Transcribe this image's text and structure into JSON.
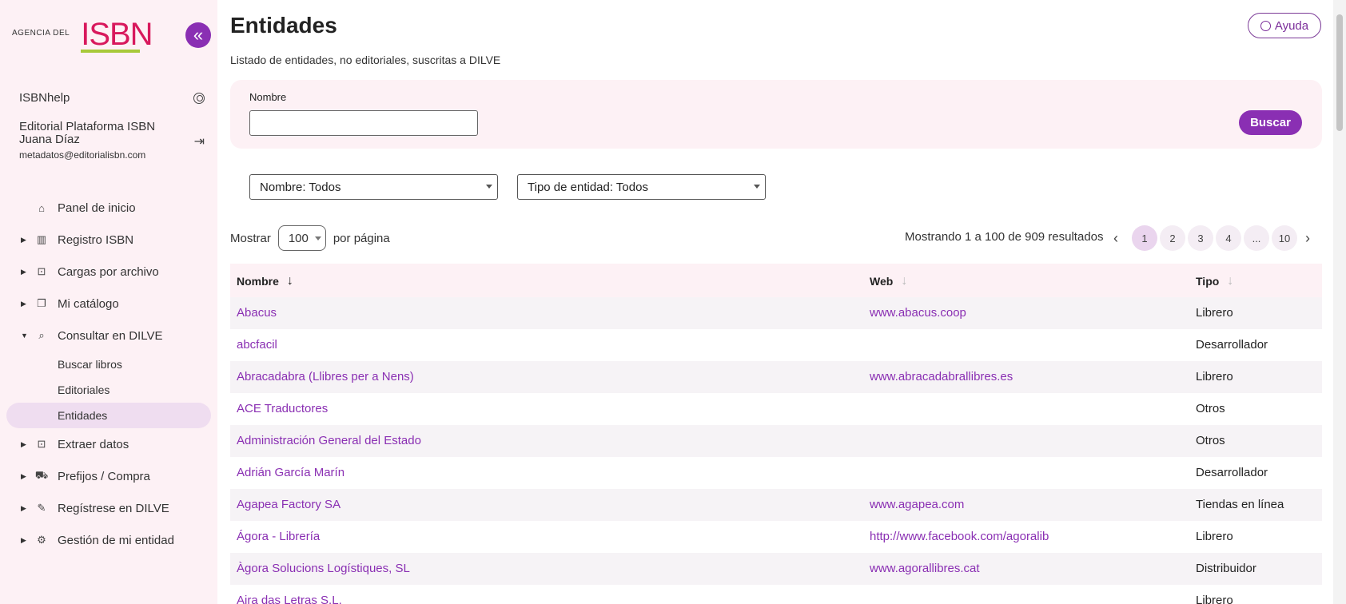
{
  "sidebar": {
    "logo": {
      "agency": "AGENCIA DEL",
      "brand": "ISBN"
    },
    "help_link": "ISBNhelp",
    "user": {
      "org": "Editorial Plataforma ISBN",
      "name": "Juana Díaz",
      "email": "metadatos@editorialisbn.com"
    },
    "nav": [
      {
        "label": "Panel de inicio",
        "icon": "home-icon"
      },
      {
        "label": "Registro ISBN",
        "icon": "barcode-icon"
      },
      {
        "label": "Cargas por archivo",
        "icon": "upload-icon"
      },
      {
        "label": "Mi catálogo",
        "icon": "catalog-icon"
      },
      {
        "label": "Consultar en DILVE",
        "icon": "search-icon"
      },
      {
        "label": "Extraer datos",
        "icon": "download-icon"
      },
      {
        "label": "Prefijos / Compra",
        "icon": "cart-icon"
      },
      {
        "label": "Regístrese en DILVE",
        "icon": "register-icon"
      },
      {
        "label": "Gestión de mi entidad",
        "icon": "gear-icon"
      }
    ],
    "subnav": [
      "Buscar libros",
      "Editoriales",
      "Entidades"
    ]
  },
  "header": {
    "title": "Entidades",
    "subtitle": "Listado de entidades, no editoriales, suscritas a DILVE",
    "help_button": "Ayuda"
  },
  "search": {
    "label": "Nombre",
    "value": "",
    "button": "Buscar"
  },
  "filters": {
    "nombre": "Nombre: Todos",
    "tipo": "Tipo de entidad: Todos"
  },
  "pagination": {
    "show_label": "Mostrar",
    "per_page": "100",
    "per_page_suffix": "por página",
    "results": "Mostrando 1 a 100 de 909 resultados",
    "pages": [
      "1",
      "2",
      "3",
      "4",
      "...",
      "10"
    ],
    "current": "1"
  },
  "table": {
    "columns": [
      "Nombre",
      "Web",
      "Tipo"
    ],
    "rows": [
      {
        "nombre": "Abacus",
        "web": "www.abacus.coop",
        "tipo": "Librero"
      },
      {
        "nombre": "abcfacil",
        "web": "",
        "tipo": "Desarrollador"
      },
      {
        "nombre": "Abracadabra (Llibres per a Nens)",
        "web": "www.abracadabrallibres.es",
        "tipo": "Librero"
      },
      {
        "nombre": "ACE Traductores",
        "web": "",
        "tipo": "Otros"
      },
      {
        "nombre": "Administración General del Estado",
        "web": "",
        "tipo": "Otros"
      },
      {
        "nombre": "Adrián García Marín",
        "web": "",
        "tipo": "Desarrollador"
      },
      {
        "nombre": "Agapea Factory SA",
        "web": "www.agapea.com",
        "tipo": "Tiendas en línea"
      },
      {
        "nombre": "Ágora - Librería",
        "web": "http://www.facebook.com/agoralib",
        "tipo": "Librero"
      },
      {
        "nombre": "Àgora Solucions Logístiques, SL",
        "web": "www.agorallibres.cat",
        "tipo": "Distribuidor"
      },
      {
        "nombre": "Aira das Letras S.L.",
        "web": "",
        "tipo": "Librero"
      }
    ]
  },
  "colors": {
    "accent": "#8a2fb3",
    "brand": "#d8195d",
    "sidebar_bg": "#fdf1f5"
  }
}
